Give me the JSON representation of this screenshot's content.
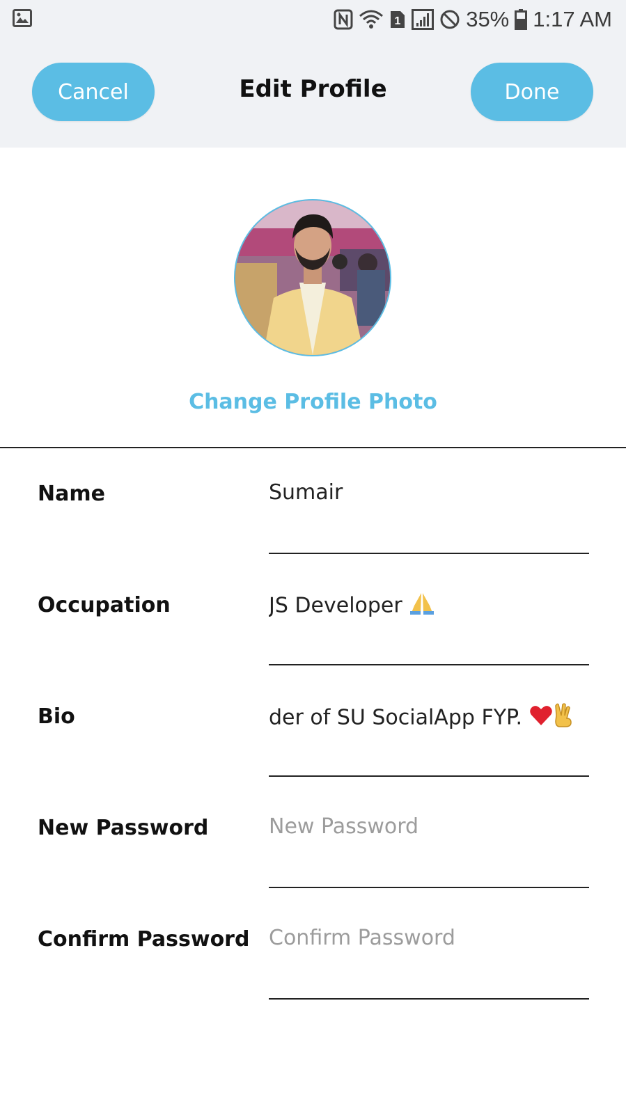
{
  "status_bar": {
    "battery_percent": "35%",
    "time": "1:17 AM",
    "sim_badge": "1",
    "icons": [
      "image-icon",
      "nfc-icon",
      "wifi-icon",
      "sim-icon",
      "signal-icon",
      "do-not-disturb-icon",
      "battery-icon"
    ]
  },
  "header": {
    "cancel_label": "Cancel",
    "title": "Edit Profile",
    "done_label": "Done"
  },
  "profile": {
    "change_photo_label": "Change Profile Photo"
  },
  "form": {
    "fields": [
      {
        "label": "Name",
        "value": "Sumair",
        "placeholder": ""
      },
      {
        "label": "Occupation",
        "value": "JS Developer",
        "placeholder": "",
        "emoji": "folded-hands"
      },
      {
        "label": "Bio",
        "value": "der of SU SocialApp FYP.",
        "placeholder": "",
        "emoji": "heart-and-victory"
      },
      {
        "label": "New Password",
        "value": "",
        "placeholder": "New Password"
      },
      {
        "label": "Confirm Password",
        "value": "",
        "placeholder": "Confirm Password"
      }
    ]
  },
  "colors": {
    "accent": "#5bbde4",
    "header_bg": "#f0f2f5",
    "text": "#111111",
    "placeholder": "#9c9c9c"
  }
}
